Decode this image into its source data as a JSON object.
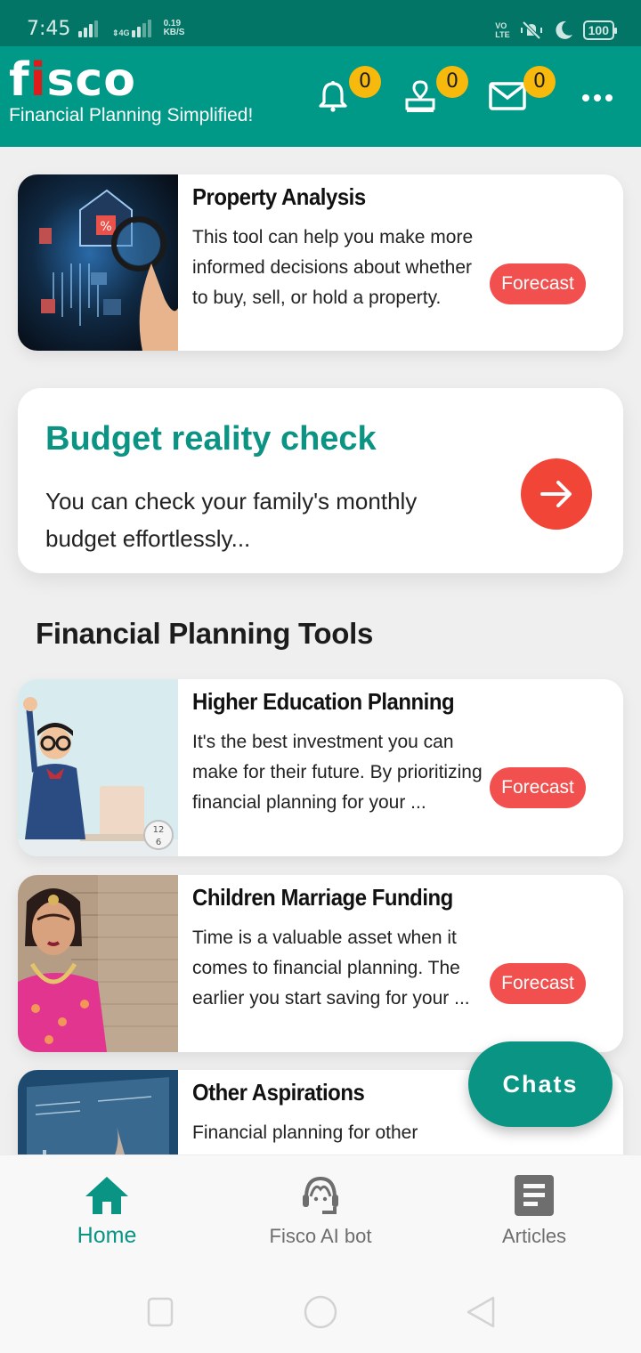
{
  "status_bar": {
    "time": "7:45",
    "network_type": "4G",
    "data_speed_value": "0.19",
    "data_speed_unit": "KB/S",
    "volte_label_top": "VO",
    "volte_label_bottom": "LTE",
    "battery": "100",
    "icons": [
      "signal-icon",
      "signal-4g-icon",
      "volte-icon",
      "vibrate-off-icon",
      "do-not-disturb-moon-icon",
      "battery-icon"
    ]
  },
  "app_bar": {
    "logo_text_f": "f",
    "logo_text_i": "i",
    "logo_text_rest": "sco",
    "tagline": "Financial Planning Simplified!",
    "notifications_count": "0",
    "appointments_count": "0",
    "messages_count": "0",
    "icons": [
      "bell-icon",
      "stamp-icon",
      "mail-icon",
      "more-horizontal-icon"
    ]
  },
  "featured_card": {
    "title": "Property Analysis",
    "description": "This tool can help you make more informed decisions about whether to buy, sell, or hold a property.",
    "button_label": "Forecast",
    "image": "property-analysis-thumbnail"
  },
  "budget_card": {
    "title": "Budget reality check",
    "description": "You can check your family's monthly budget effortlessly...",
    "action_icon": "arrow-right-icon"
  },
  "tools_section": {
    "title": "Financial Planning Tools",
    "items": [
      {
        "title": "Higher Education Planning",
        "description": "It's the best investment you can make for their future. By prioritizing financial planning for your ...",
        "button_label": "Forecast",
        "image": "education-thumbnail"
      },
      {
        "title": "Children Marriage Funding",
        "description": "Time is a valuable asset when it comes to financial planning. The earlier you start saving for your ...",
        "button_label": "Forecast",
        "image": "marriage-thumbnail"
      },
      {
        "title": "Other Aspirations",
        "description": "Financial planning for other",
        "image": "aspirations-thumbnail"
      }
    ]
  },
  "chats_button": {
    "label": "Chats"
  },
  "bottom_nav": {
    "items": [
      {
        "label": "Home",
        "icon": "home-icon",
        "active": true
      },
      {
        "label": "Fisco AI bot",
        "icon": "headset-agent-icon",
        "active": false
      },
      {
        "label": "Articles",
        "icon": "article-icon",
        "active": false
      }
    ]
  },
  "colors": {
    "status_bar": "#037566",
    "brand_teal": "#009887",
    "badge_yellow": "#f7b90c",
    "forecast_red": "#f2504f",
    "arrow_red": "#f04537",
    "logo_red": "#e01b1b"
  }
}
